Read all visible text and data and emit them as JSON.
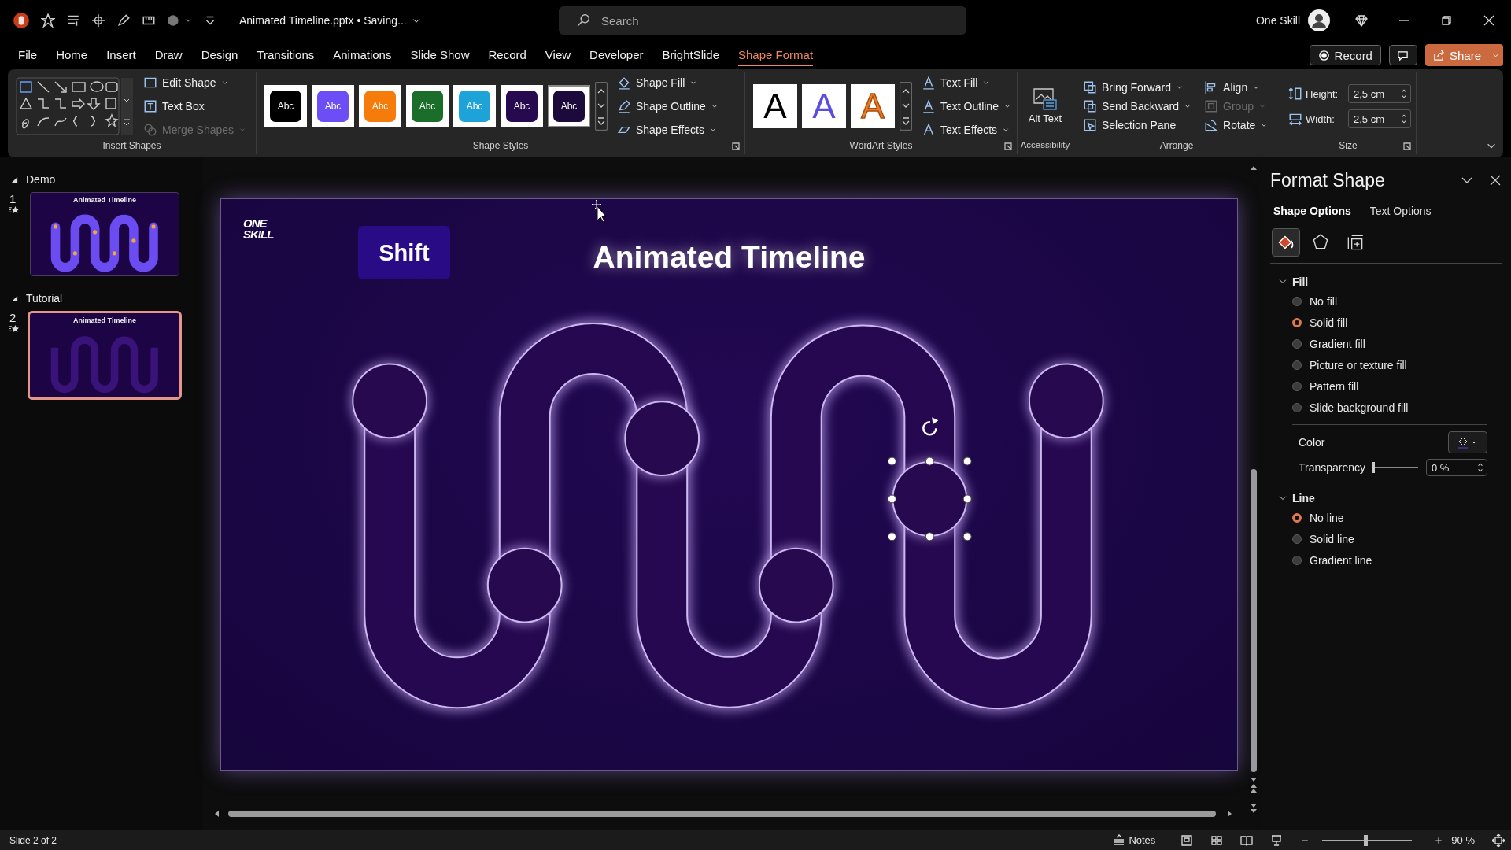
{
  "title_bar": {
    "document": "Animated Timeline.pptx • Saving...",
    "search": {
      "placeholder": "Search"
    },
    "account": "One Skill"
  },
  "menu_tabs": [
    {
      "label": "File",
      "selected": false
    },
    {
      "label": "Home",
      "selected": false
    },
    {
      "label": "Insert",
      "selected": false
    },
    {
      "label": "Draw",
      "selected": false
    },
    {
      "label": "Design",
      "selected": false
    },
    {
      "label": "Transitions",
      "selected": false
    },
    {
      "label": "Animations",
      "selected": false
    },
    {
      "label": "Slide Show",
      "selected": false
    },
    {
      "label": "Record",
      "selected": false
    },
    {
      "label": "View",
      "selected": false
    },
    {
      "label": "Developer",
      "selected": false
    },
    {
      "label": "BrightSlide",
      "selected": false
    },
    {
      "label": "Shape Format",
      "selected": true
    }
  ],
  "header_actions": {
    "record": "Record",
    "share": "Share"
  },
  "ribbon": {
    "insert_shapes": {
      "label": "Insert Shapes",
      "buttons": [
        {
          "label": "Edit Shape",
          "disabled": false,
          "dropdown": true
        },
        {
          "label": "Text Box",
          "disabled": false,
          "dropdown": false
        },
        {
          "label": "Merge Shapes",
          "disabled": true,
          "dropdown": true
        }
      ]
    },
    "shape_styles": {
      "label": "Shape Styles",
      "swatches": [
        {
          "text": "Abc",
          "color": "#000000",
          "selected": false
        },
        {
          "text": "Abc",
          "color": "#6b4ef5",
          "selected": false
        },
        {
          "text": "Abc",
          "color": "#f57c0a",
          "selected": false
        },
        {
          "text": "Abc",
          "color": "#1b6e2a",
          "selected": false
        },
        {
          "text": "Abc",
          "color": "#1ea3d8",
          "selected": false
        },
        {
          "text": "Abc",
          "color": "#26094f",
          "selected": false
        },
        {
          "text": "Abc",
          "color": "#1c0a3d",
          "selected": true
        }
      ],
      "buttons": [
        {
          "label": "Shape Fill",
          "disabled": false,
          "dropdown": true
        },
        {
          "label": "Shape Outline",
          "disabled": false,
          "dropdown": true
        },
        {
          "label": "Shape Effects",
          "disabled": false,
          "dropdown": true
        }
      ]
    },
    "wordart_styles": {
      "label": "WordArt Styles",
      "samples": [
        {
          "text": "A",
          "color": "#000000",
          "kind": "solid"
        },
        {
          "text": "A",
          "color": "#5b4de0",
          "kind": "solid"
        },
        {
          "text": "A",
          "color": "#ef7d22",
          "kind": "outline"
        }
      ],
      "buttons": [
        {
          "label": "Text Fill",
          "disabled": false,
          "dropdown": true
        },
        {
          "label": "Text Outline",
          "disabled": false,
          "dropdown": true
        },
        {
          "label": "Text Effects",
          "disabled": false,
          "dropdown": true
        }
      ]
    },
    "accessibility": {
      "label": "Accessibility",
      "button": "Alt Text"
    },
    "arrange": {
      "label": "Arrange",
      "buttons": [
        {
          "label": "Bring Forward",
          "disabled": false,
          "dropdown": true
        },
        {
          "label": "Send Backward",
          "disabled": false,
          "dropdown": true
        },
        {
          "label": "Selection Pane",
          "disabled": false,
          "dropdown": false
        },
        {
          "label": "Align",
          "disabled": false,
          "dropdown": true
        },
        {
          "label": "Group",
          "disabled": true,
          "dropdown": true
        },
        {
          "label": "Rotate",
          "disabled": false,
          "dropdown": true
        }
      ]
    },
    "size": {
      "label": "Size",
      "fields": [
        {
          "label": "Height:",
          "value": "2,5 cm"
        },
        {
          "label": "Width:",
          "value": "2,5 cm"
        }
      ]
    }
  },
  "slides_panel": {
    "sections": [
      {
        "name": "Demo",
        "expanded": true,
        "slides": [
          {
            "number": "1",
            "kind": "timeline",
            "title": "Animated Timeline",
            "selected": false
          }
        ]
      },
      {
        "name": "Tutorial",
        "expanded": true,
        "slides": [
          {
            "number": "2",
            "kind": "outline",
            "title": "Animated Timeline",
            "selected": true
          }
        ]
      }
    ]
  },
  "slide": {
    "logo": [
      "ONE",
      "SKILL"
    ],
    "tag": "Shift",
    "title": "Animated Timeline"
  },
  "format_pane": {
    "title": "Format Shape",
    "tabs": [
      {
        "label": "Shape Options",
        "selected": true
      },
      {
        "label": "Text Options",
        "selected": false
      }
    ],
    "icon_tabs": [
      {
        "selected": true
      },
      {
        "selected": false
      },
      {
        "selected": false
      }
    ],
    "sections": [
      {
        "title": "Fill",
        "expanded": true,
        "options": [
          {
            "label": "No fill",
            "selected": false
          },
          {
            "label": "Solid fill",
            "selected": true
          },
          {
            "label": "Gradient fill",
            "selected": false
          },
          {
            "label": "Picture or texture fill",
            "selected": false
          },
          {
            "label": "Pattern fill",
            "selected": false
          },
          {
            "label": "Slide background fill",
            "selected": false
          }
        ],
        "color": {
          "label": "Color"
        },
        "transparency": {
          "label": "Transparency",
          "level": 0,
          "value": "0 %"
        }
      },
      {
        "title": "Line",
        "expanded": true,
        "options": [
          {
            "label": "No line",
            "selected": true
          },
          {
            "label": "Solid line",
            "selected": false
          },
          {
            "label": "Gradient line",
            "selected": false
          }
        ]
      }
    ]
  },
  "status_bar": {
    "slide_info": "Slide 2 of 2",
    "notes": "Notes",
    "zoom": {
      "level": 0.48,
      "value": "90 %"
    }
  }
}
